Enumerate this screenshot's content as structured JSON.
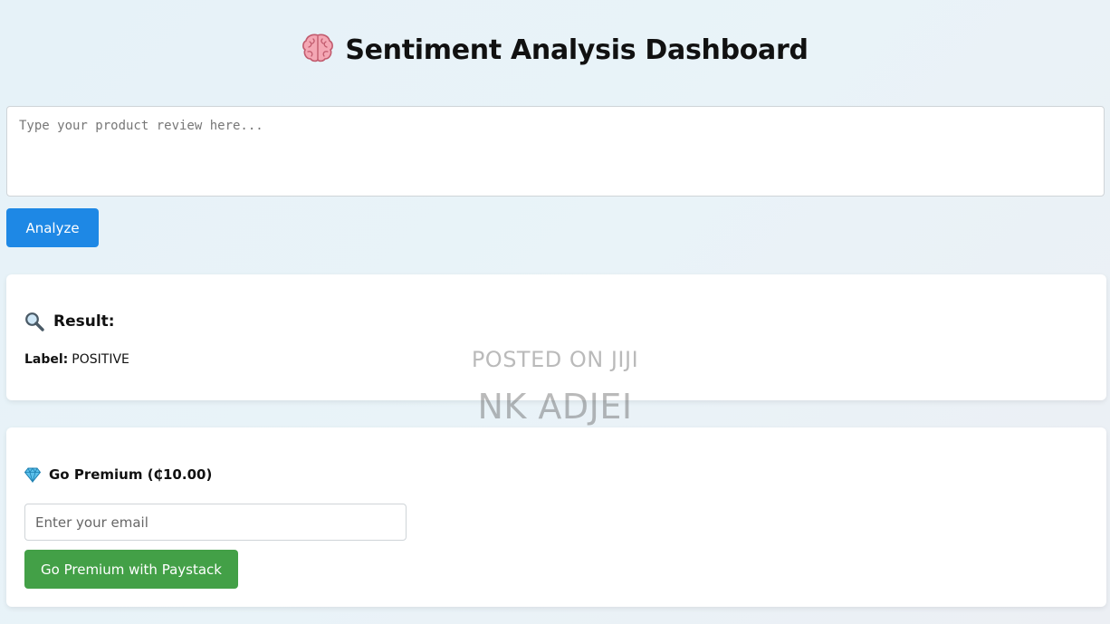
{
  "header": {
    "icon": "brain-icon",
    "title": "Sentiment Analysis Dashboard"
  },
  "review": {
    "placeholder": "Type your product review here...",
    "value": ""
  },
  "analyze_button": {
    "label": "Analyze",
    "color": "#1e88e5"
  },
  "result": {
    "icon": "magnifier-icon",
    "heading": "Result:",
    "label_key": "Label:",
    "label_value": "POSITIVE"
  },
  "premium": {
    "icon": "gem-icon",
    "heading": "Go Premium (₵10.00)",
    "email_placeholder": "Enter your email",
    "email_value": "",
    "button_label": "Go Premium with Paystack",
    "button_color": "#43a047"
  },
  "watermark": {
    "line1": "POSTED ON JIJI",
    "line2": "NK ADJEI"
  }
}
